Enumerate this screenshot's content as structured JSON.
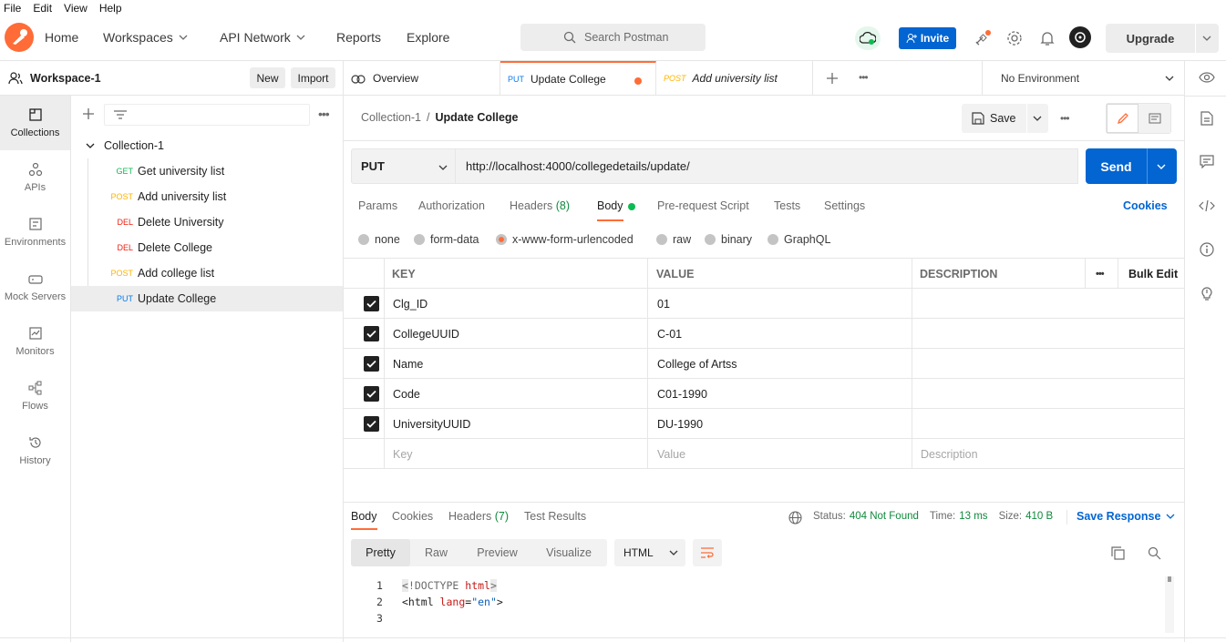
{
  "menubar": [
    "File",
    "Edit",
    "View",
    "Help"
  ],
  "header": {
    "nav": {
      "home": "Home",
      "workspaces": "Workspaces",
      "api_network": "API Network",
      "reports": "Reports",
      "explore": "Explore"
    },
    "search_placeholder": "Search Postman",
    "invite": "Invite",
    "upgrade": "Upgrade"
  },
  "workspace": {
    "name": "Workspace-1",
    "new": "New",
    "import": "Import"
  },
  "rail": [
    {
      "label": "Collections",
      "icon": "collections-icon"
    },
    {
      "label": "APIs",
      "icon": "apis-icon"
    },
    {
      "label": "Environments",
      "icon": "environments-icon"
    },
    {
      "label": "Mock Servers",
      "icon": "mock-servers-icon"
    },
    {
      "label": "Monitors",
      "icon": "monitors-icon"
    },
    {
      "label": "Flows",
      "icon": "flows-icon"
    },
    {
      "label": "History",
      "icon": "history-icon"
    }
  ],
  "collection": {
    "name": "Collection-1",
    "requests": [
      {
        "method": "GET",
        "name": "Get university list"
      },
      {
        "method": "POST",
        "name": "Add university list"
      },
      {
        "method": "DEL",
        "name": "Delete University"
      },
      {
        "method": "DEL",
        "name": "Delete College"
      },
      {
        "method": "POST",
        "name": "Add college list"
      },
      {
        "method": "PUT",
        "name": "Update College"
      }
    ]
  },
  "tabs": {
    "overview": "Overview",
    "active": {
      "method": "PUT",
      "name": "Update College"
    },
    "other": {
      "method": "POST",
      "name": "Add university list"
    }
  },
  "environment": "No Environment",
  "breadcrumb": {
    "collection": "Collection-1",
    "separator": "/",
    "request": "Update College"
  },
  "save": "Save",
  "request": {
    "method": "PUT",
    "url": "http://localhost:4000/collegedetails/update/",
    "send": "Send",
    "tabs": {
      "params": "Params",
      "authorization": "Authorization",
      "headers": "Headers",
      "headers_count": "(8)",
      "body": "Body",
      "prerequest": "Pre-request Script",
      "tests": "Tests",
      "settings": "Settings"
    },
    "cookies": "Cookies",
    "body_types": [
      "none",
      "form-data",
      "x-www-form-urlencoded",
      "raw",
      "binary",
      "GraphQL"
    ],
    "selected_body_type": "x-www-form-urlencoded"
  },
  "table": {
    "headers": {
      "key": "KEY",
      "value": "VALUE",
      "description": "DESCRIPTION",
      "bulk_edit": "Bulk Edit"
    },
    "rows": [
      {
        "key": "Clg_ID",
        "value": "01",
        "checked": true
      },
      {
        "key": "CollegeUUID",
        "value": "C-01",
        "checked": true
      },
      {
        "key": "Name",
        "value": "College of Artss",
        "checked": true
      },
      {
        "key": "Code",
        "value": "C01-1990",
        "checked": true
      },
      {
        "key": "UniversityUUID",
        "value": "DU-1990",
        "checked": true
      }
    ],
    "placeholders": {
      "key": "Key",
      "value": "Value",
      "description": "Description"
    }
  },
  "response": {
    "tabs": {
      "body": "Body",
      "cookies": "Cookies",
      "headers": "Headers",
      "headers_count": "(7)",
      "test_results": "Test Results"
    },
    "status_label": "Status:",
    "status_value": "404 Not Found",
    "time_label": "Time:",
    "time_value": "13 ms",
    "size_label": "Size:",
    "size_value": "410 B",
    "save_response": "Save Response",
    "views": {
      "pretty": "Pretty",
      "raw": "Raw",
      "preview": "Preview",
      "visualize": "Visualize"
    },
    "format": "HTML",
    "code": {
      "line1": {
        "num": "1",
        "open": "<",
        "tag": "!DOCTYPE",
        "space": " ",
        "attr": "html",
        "close": ">"
      },
      "line2": {
        "num": "2",
        "text_open": "<html ",
        "attr": "lang",
        "eq": "=",
        "val": "\"en\"",
        "close": ">"
      },
      "line3": {
        "num": "3"
      }
    }
  },
  "colors": {
    "accent": "#ff6c37",
    "blue": "#0265d2",
    "green": "#0cbb52",
    "get": "#0cbb52",
    "post": "#ffb400",
    "del": "#eb2013",
    "put": "#097bed",
    "status": "#0f8a3c"
  }
}
